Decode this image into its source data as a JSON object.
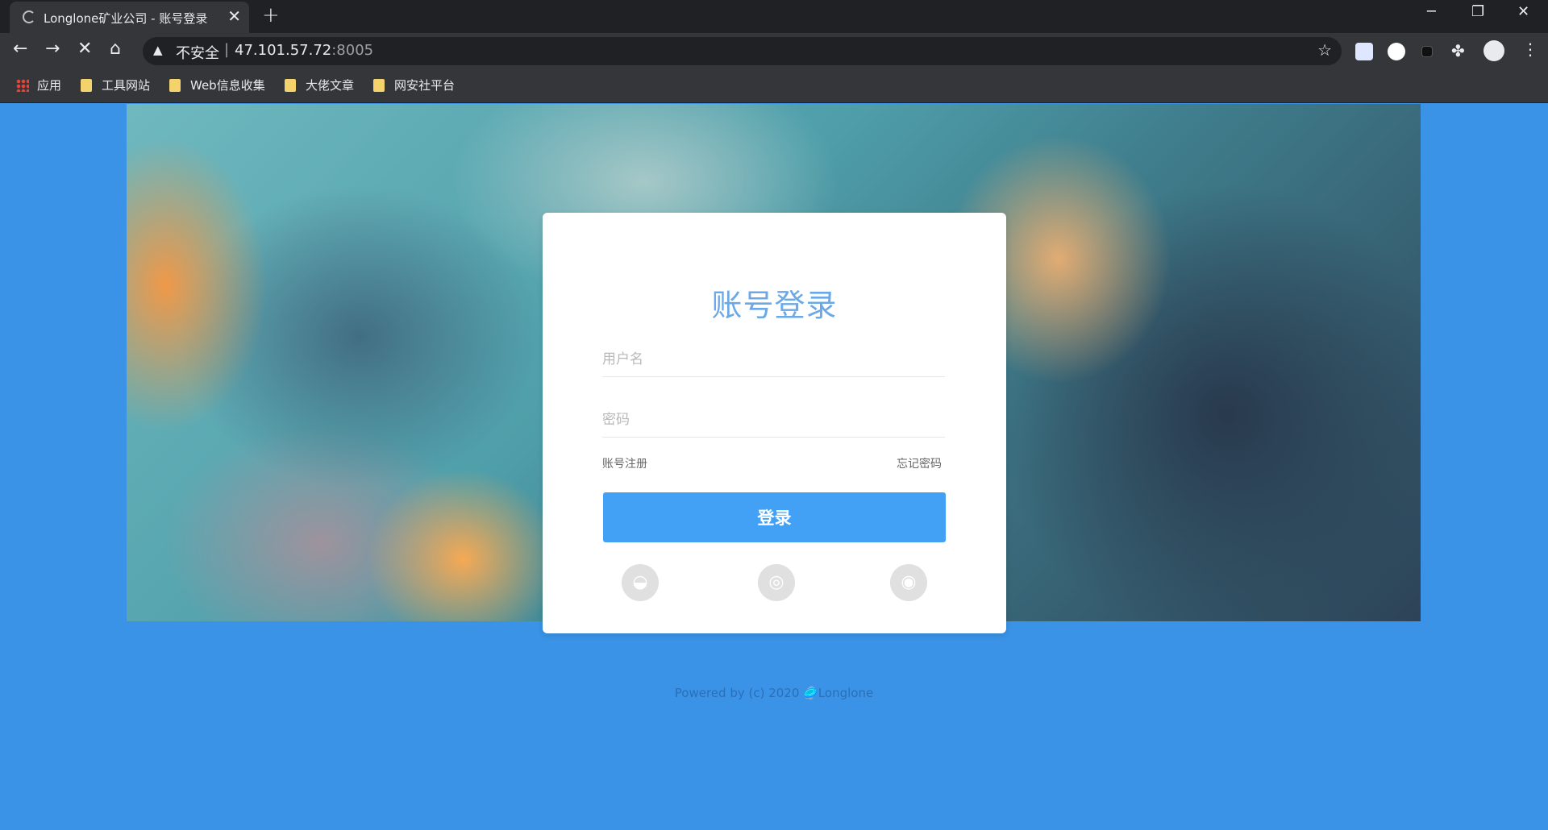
{
  "browser": {
    "tab_title": "Longlone矿业公司 - 账号登录",
    "tab_close": "✕",
    "new_tab": "+",
    "window_controls": [
      "─",
      "❐",
      "✕"
    ],
    "address": {
      "security_label": "不安全",
      "separator": "|",
      "host": "47.101.57.72",
      "port": ":8005"
    },
    "bookmarks": [
      {
        "label": "应用",
        "icon": "apps-icon"
      },
      {
        "label": "工具网站",
        "icon": "folder-icon"
      },
      {
        "label": "Web信息收集",
        "icon": "folder-icon"
      },
      {
        "label": "大佬文章",
        "icon": "folder-icon"
      },
      {
        "label": "网安社平台",
        "icon": "folder-icon"
      }
    ]
  },
  "login": {
    "heading": "账号登录",
    "username_placeholder": "用户名",
    "password_placeholder": "密码",
    "register_link": "账号注册",
    "forgot_link": "忘记密码",
    "submit_label": "登录",
    "social": [
      {
        "name": "qq",
        "icon": "qq-icon"
      },
      {
        "name": "wechat",
        "icon": "wechat-icon"
      },
      {
        "name": "weibo",
        "icon": "weibo-icon"
      }
    ]
  },
  "footer": {
    "text": "Powered by (c) 2020 🥏Longlone"
  },
  "colors": {
    "page_background": "#3a93e6",
    "heading": "#6aa8e8",
    "button": "#42a1f5"
  }
}
